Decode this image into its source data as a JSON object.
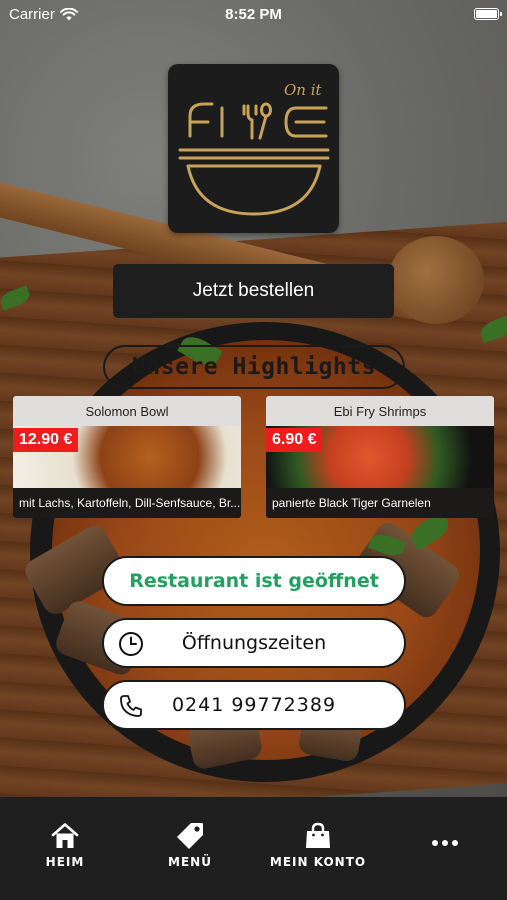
{
  "status_bar": {
    "carrier": "Carrier",
    "time": "8:52 PM"
  },
  "logo": {
    "wordmark": "FIVE",
    "tagline": "On it"
  },
  "order_button": {
    "label": "Jetzt bestellen"
  },
  "highlights": {
    "title": "Unsere Highlights",
    "items": [
      {
        "name": "Solomon Bowl",
        "price": "12.90 €",
        "description": "mit Lachs, Kartoffeln, Dill-Senfsauce, Br..."
      },
      {
        "name": "Ebi Fry Shrimps",
        "price": "6.90 €",
        "description": "panierte Black Tiger Garnelen"
      }
    ]
  },
  "status_button": {
    "label": "Restaurant ist geöffnet",
    "color": "#22a060"
  },
  "hours_button": {
    "label": "Öffnungszeiten",
    "icon": "clock-icon"
  },
  "phone_button": {
    "label": "0241 99772389",
    "icon": "phone-icon"
  },
  "tab_bar": {
    "items": [
      {
        "label": "HEIM",
        "icon": "home-icon"
      },
      {
        "label": "MENÜ",
        "icon": "tag-icon"
      },
      {
        "label": "MEIN KONTO",
        "icon": "shopping-bag-icon"
      },
      {
        "label": "",
        "icon": "more-dots-icon"
      }
    ]
  },
  "colors": {
    "price_tag": "#ee1c1c",
    "tab_bar": "#1f1f1f",
    "logo_gold": "#c9a35a"
  }
}
